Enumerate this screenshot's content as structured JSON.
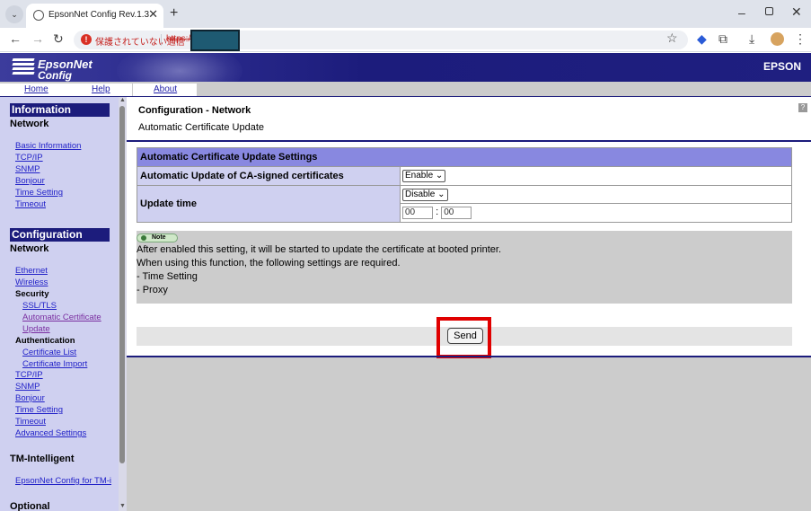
{
  "browser": {
    "tab_title": "EpsonNet Config Rev.1.3",
    "security_text": "保護されていない通信",
    "url_prefix": "https://",
    "url_redacted": ""
  },
  "header": {
    "logo_line1": "EpsonNet",
    "logo_line2": "Config",
    "brand": "EPSON",
    "nav": {
      "home": "Home",
      "help": "Help",
      "about": "About"
    }
  },
  "sidebar": {
    "information": {
      "heading": "Information",
      "subheading": "Network",
      "links": [
        "Basic Information",
        "TCP/IP",
        "SNMP",
        "Bonjour",
        "Time Setting",
        "Timeout"
      ]
    },
    "configuration": {
      "heading": "Configuration",
      "subheading": "Network",
      "ethernet": "Ethernet",
      "wireless": "Wireless",
      "security_label": "Security",
      "ssl_tls": "SSL/TLS",
      "auto_cert_line1": "Automatic Certificate",
      "auto_cert_line2": "Update",
      "authentication_label": "Authentication",
      "certificate_list": "Certificate List",
      "certificate_import": "Certificate Import",
      "tcpip": "TCP/IP",
      "snmp": "SNMP",
      "bonjour": "Bonjour",
      "time_setting": "Time Setting",
      "timeout": "Timeout",
      "advanced_settings": "Advanced Settings"
    },
    "tm_intelligent": {
      "heading": "TM-Intelligent",
      "link": "EpsonNet Config for TM-i"
    },
    "optional": {
      "heading": "Optional"
    }
  },
  "main": {
    "title": "Configuration - Network",
    "subtitle": "Automatic Certificate Update",
    "table": {
      "header": "Automatic Certificate Update Settings",
      "row1_label": "Automatic Update of CA-signed certificates",
      "row1_value": "Enable",
      "row2_label": "Update time",
      "row2_select": "Disable",
      "hour": "00",
      "time_sep": ":",
      "minute": "00"
    },
    "note": {
      "badge": "Note",
      "lines": [
        "After enabled this setting, it will be started to update the certificate at booted printer.",
        "When using this function, the following settings are required.",
        "- Time Setting",
        "- Proxy"
      ]
    },
    "send_button": "Send"
  },
  "colors": {
    "banner": "#1c1c7c",
    "sidebar_bg": "#cfd0f0",
    "table_header": "#8888e0",
    "highlight": "#e00000"
  }
}
